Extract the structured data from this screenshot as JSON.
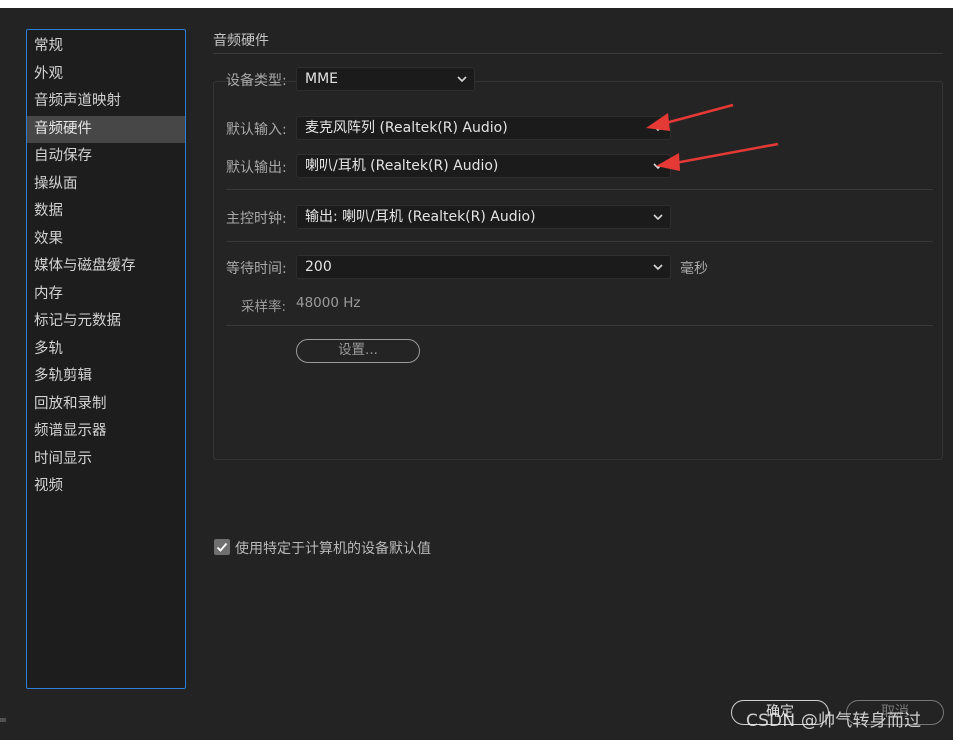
{
  "sidebar": {
    "items": [
      {
        "label": "常规"
      },
      {
        "label": "外观"
      },
      {
        "label": "音频声道映射"
      },
      {
        "label": "音频硬件"
      },
      {
        "label": "自动保存"
      },
      {
        "label": "操纵面"
      },
      {
        "label": "数据"
      },
      {
        "label": "效果"
      },
      {
        "label": "媒体与磁盘缓存"
      },
      {
        "label": "内存"
      },
      {
        "label": "标记与元数据"
      },
      {
        "label": "多轨"
      },
      {
        "label": "多轨剪辑"
      },
      {
        "label": "回放和录制"
      },
      {
        "label": "频谱显示器"
      },
      {
        "label": "时间显示"
      },
      {
        "label": "视频"
      }
    ],
    "selected_index": 3
  },
  "section": {
    "title": "音频硬件"
  },
  "device_type": {
    "label": "设备类型:",
    "value": "MME"
  },
  "default_input": {
    "label": "默认输入:",
    "value": "麦克风阵列 (Realtek(R) Audio)"
  },
  "default_output": {
    "label": "默认输出:",
    "value": "喇叭/耳机 (Realtek(R) Audio)"
  },
  "master_clock": {
    "label": "主控时钟:",
    "value": "输出: 喇叭/耳机 (Realtek(R) Audio)"
  },
  "latency": {
    "label": "等待时间:",
    "value": "200",
    "unit": "毫秒"
  },
  "sample_rate": {
    "label": "采样率:",
    "value": "48000 Hz"
  },
  "settings_button": {
    "label": "设置..."
  },
  "use_machine_defaults": {
    "label": "使用特定于计算机的设备默认值",
    "checked": true
  },
  "footer": {
    "ok_label": "确定",
    "cancel_label": "取消"
  },
  "watermark": {
    "text": "CSDN @帅气转身而过"
  },
  "colors": {
    "sidebar_border": "#2d7fd6",
    "annotation_arrow": "#e53935",
    "selected_bg": "#474747"
  }
}
